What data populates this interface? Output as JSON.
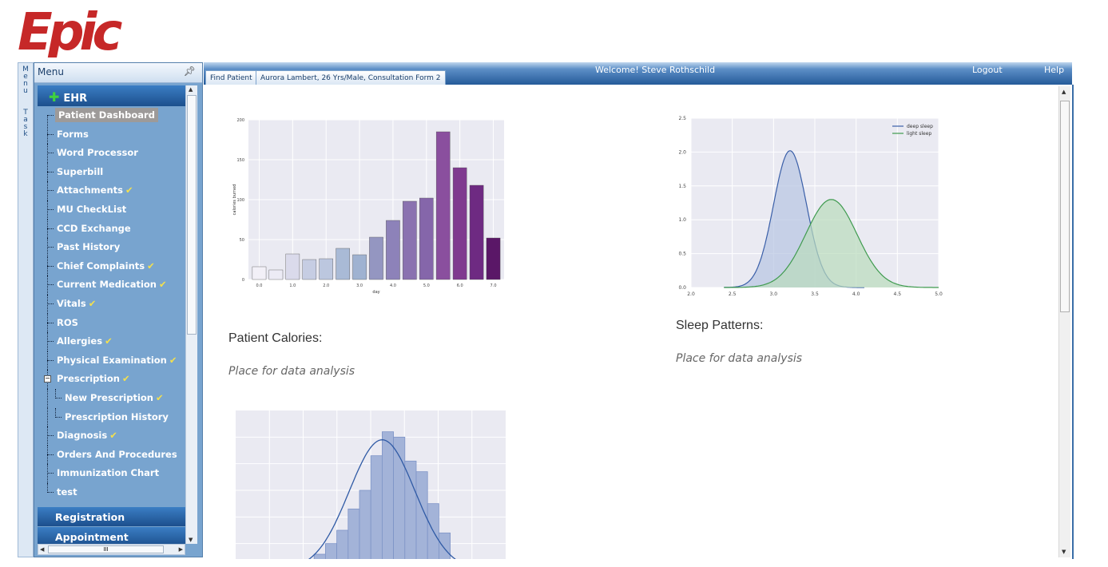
{
  "app": {
    "logo_text": "Epic",
    "logo_color": "#c62828"
  },
  "side_tabs": {
    "menu": "Menu",
    "task": "Task"
  },
  "menu": {
    "title": "Menu",
    "ehr_label": "EHR",
    "items": [
      {
        "label": "Patient Dashboard",
        "checked": false,
        "active": true
      },
      {
        "label": "Forms",
        "checked": false
      },
      {
        "label": "Word Processor",
        "checked": false
      },
      {
        "label": "Superbill",
        "checked": false
      },
      {
        "label": "Attachments",
        "checked": true
      },
      {
        "label": "MU CheckList",
        "checked": false
      },
      {
        "label": "CCD Exchange",
        "checked": false
      },
      {
        "label": "Past History",
        "checked": false
      },
      {
        "label": "Chief Complaints",
        "checked": true
      },
      {
        "label": "Current Medication",
        "checked": true
      },
      {
        "label": "Vitals",
        "checked": true
      },
      {
        "label": "ROS",
        "checked": false
      },
      {
        "label": "Allergies",
        "checked": true
      },
      {
        "label": "Physical Examination",
        "checked": true
      },
      {
        "label": "Prescription",
        "checked": true,
        "expanded": true
      },
      {
        "label": "New Prescription",
        "checked": true,
        "sub": true
      },
      {
        "label": "Prescription History",
        "checked": false,
        "sub": true
      },
      {
        "label": "Diagnosis",
        "checked": true
      },
      {
        "label": "Orders And Procedures",
        "checked": false
      },
      {
        "label": "Immunization Chart",
        "checked": false
      },
      {
        "label": "test",
        "checked": false
      }
    ],
    "sections": [
      "Registration",
      "Appointment"
    ],
    "hscroll_grip": "III"
  },
  "topbar": {
    "tabs": [
      "Find Patient",
      "Aurora Lambert, 26 Yrs/Male, Consultation Form 2"
    ],
    "welcome": "Welcome! Steve Rothschild",
    "logout": "Logout",
    "help": "Help"
  },
  "dashboard": {
    "calories": {
      "title": "Patient Calories:",
      "desc": "Place for data analysis"
    },
    "sleep": {
      "title": "Sleep Patterns:",
      "desc": "Place for data analysis"
    }
  },
  "chart_data": [
    {
      "type": "bar",
      "xlabel": "day",
      "ylabel": "calories burned",
      "ylim": [
        0,
        200
      ],
      "yticks": [
        0,
        50,
        100,
        150,
        200
      ],
      "xticks": [
        "0.0",
        "1.0",
        "2.0",
        "3.0",
        "4.0",
        "5.0",
        "6.0",
        "7.0"
      ],
      "values": [
        16,
        12,
        32,
        25,
        26,
        39,
        31,
        53,
        74,
        98,
        102,
        185,
        140,
        118,
        52
      ],
      "colors": [
        "#f2f0f7",
        "#ecebf5",
        "#dadaeb",
        "#c6cde3",
        "#bcc7df",
        "#a9bad6",
        "#9fb2d1",
        "#9496c1",
        "#8d82b9",
        "#8a72b0",
        "#8566aa",
        "#8a4f9e",
        "#7f3a8f",
        "#6e2a82",
        "#5a1767"
      ],
      "grid": true
    },
    {
      "type": "area",
      "xlim": [
        2.0,
        5.0
      ],
      "ylim": [
        0,
        2.5
      ],
      "xticks": [
        "2.0",
        "2.5",
        "3.0",
        "3.5",
        "4.0",
        "4.5",
        "5.0"
      ],
      "yticks": [
        "0.0",
        "0.5",
        "1.0",
        "1.5",
        "2.0",
        "2.5"
      ],
      "legend_position": "top-right",
      "series": [
        {
          "name": "deep sleep",
          "mean": 3.2,
          "sd": 0.2,
          "peak": 2.02,
          "range": [
            2.4,
            4.1
          ],
          "color": "#3a5fa8",
          "fill": "#b7c4e3"
        },
        {
          "name": "light sleep",
          "mean": 3.7,
          "sd": 0.31,
          "peak": 1.3,
          "range": [
            2.4,
            5.0
          ],
          "color": "#3e9a4e",
          "fill": "#b9dcbc"
        }
      ],
      "grid": true
    },
    {
      "type": "histogram",
      "values": [
        0.05,
        0.6,
        1.0,
        1.5,
        2.3,
        3.0,
        4.3,
        5.2,
        5.0,
        4.1,
        3.7,
        2.5,
        1.4,
        0.4
      ],
      "ymax": 6.0,
      "curve_color": "#2f5aa5",
      "bar_fill": "#a3b3d8",
      "bar_stroke": "#7e94c7",
      "grid": true
    }
  ]
}
